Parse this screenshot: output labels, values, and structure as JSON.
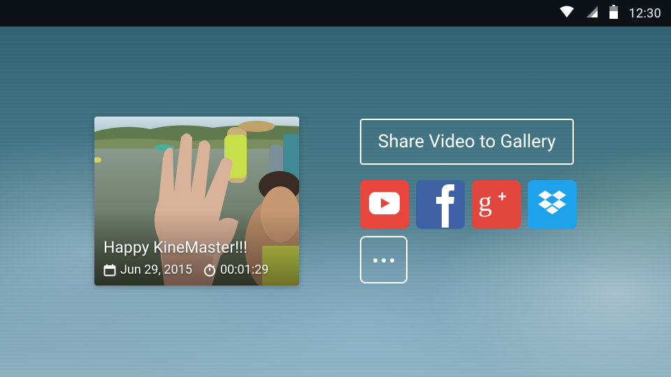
{
  "status_bar": {
    "time": "12:30",
    "icons": [
      "wifi-icon",
      "cellular-signal-icon",
      "battery-icon"
    ]
  },
  "video_card": {
    "title": "Happy KineMaster!!!",
    "date": "Jun 29, 2015",
    "duration": "00:01:29",
    "date_icon": "calendar-icon",
    "duration_icon": "stopwatch-icon"
  },
  "share": {
    "gallery_label": "Share Video to Gallery",
    "services": [
      {
        "name": "YouTube",
        "icon": "youtube-icon",
        "color": "#e53935"
      },
      {
        "name": "Facebook",
        "icon": "facebook-icon",
        "color": "#3b5998"
      },
      {
        "name": "Google+",
        "icon": "google-plus-icon",
        "color": "#dd4b39"
      },
      {
        "name": "Dropbox",
        "icon": "dropbox-icon",
        "color": "#1aa3e8"
      }
    ],
    "more_icon": "more-horizontal-icon"
  }
}
